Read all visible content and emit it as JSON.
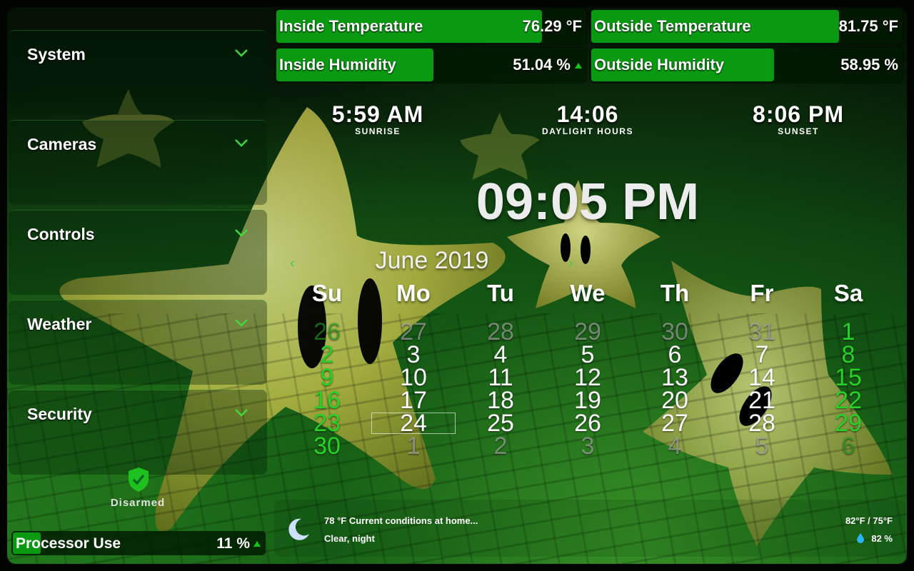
{
  "sidebar": {
    "items": [
      {
        "label": "System"
      },
      {
        "label": "Cameras"
      },
      {
        "label": "Controls"
      },
      {
        "label": "Weather"
      },
      {
        "label": "Security"
      }
    ],
    "alarm_status": "Disarmed"
  },
  "sensors": {
    "inside_temp": {
      "label": "Inside Temperature",
      "value": "76.29 °F",
      "level": 0.86
    },
    "outside_temp": {
      "label": "Outside Temperature",
      "value": "81.75 °F",
      "level": 0.8
    },
    "inside_humidity": {
      "label": "Inside Humidity",
      "value": "51.04 %",
      "level": 0.51
    },
    "outside_humidity": {
      "label": "Outside Humidity",
      "value": "58.95 %",
      "level": 0.59
    }
  },
  "sun": {
    "sunrise": {
      "time": "5:59 AM",
      "label": "SUNRISE"
    },
    "daylight": {
      "time": "14:06",
      "label": "DAYLIGHT HOURS"
    },
    "sunset": {
      "time": "8:06 PM",
      "label": "SUNSET"
    }
  },
  "clock": "09:05 PM",
  "calendar": {
    "month_label": "June 2019",
    "prev": "‹",
    "next": "›",
    "weekdays": [
      "Su",
      "Mo",
      "Tu",
      "We",
      "Th",
      "Fr",
      "Sa"
    ],
    "weeks": [
      [
        "26",
        "27",
        "28",
        "29",
        "30",
        "31",
        "1"
      ],
      [
        "2",
        "3",
        "4",
        "5",
        "6",
        "7",
        "8"
      ],
      [
        "9",
        "10",
        "11",
        "12",
        "13",
        "14",
        "15"
      ],
      [
        "16",
        "17",
        "18",
        "19",
        "20",
        "21",
        "22"
      ],
      [
        "23",
        "24",
        "25",
        "26",
        "27",
        "28",
        "29"
      ],
      [
        "30",
        "1",
        "2",
        "3",
        "4",
        "5",
        "6"
      ]
    ],
    "today": "24"
  },
  "weather": {
    "current": "78 °F Current conditions at home...",
    "condition": "Clear, night",
    "high_low": "82°F / 75°F",
    "humidity": "82 %"
  },
  "processor": {
    "label": "Processor Use",
    "value": "11 %",
    "level": 0.11
  },
  "colors": {
    "accent": "#0a9a12",
    "weekend": "#27d127"
  }
}
